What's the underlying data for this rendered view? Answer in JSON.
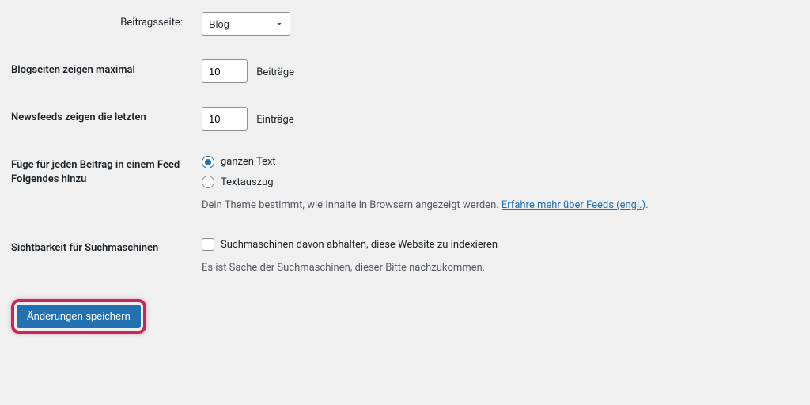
{
  "posts_page": {
    "label": "Beitragsseite:",
    "value": "Blog"
  },
  "blog_pages_max": {
    "label": "Blogseiten zeigen maximal",
    "value": "10",
    "suffix": "Beiträge"
  },
  "newsfeeds_recent": {
    "label": "Newsfeeds zeigen die letzten",
    "value": "10",
    "suffix": "Einträge"
  },
  "feed_content": {
    "label": "Füge für jeden Beitrag in einem Feed Folgendes hinzu",
    "options": {
      "full": "ganzen Text",
      "excerpt": "Textauszug"
    },
    "description_prefix": "Dein Theme bestimmt, wie Inhalte in Browsern angezeigt werden. ",
    "description_link": "Erfahre mehr über Feeds (engl.)",
    "description_suffix": "."
  },
  "search_visibility": {
    "label": "Sichtbarkeit für Suchmaschinen",
    "checkbox_label": "Suchmaschinen davon abhalten, diese Website zu indexieren",
    "description": "Es ist Sache der Suchmaschinen, dieser Bitte nachzukommen."
  },
  "submit": {
    "label": "Änderungen speichern"
  }
}
